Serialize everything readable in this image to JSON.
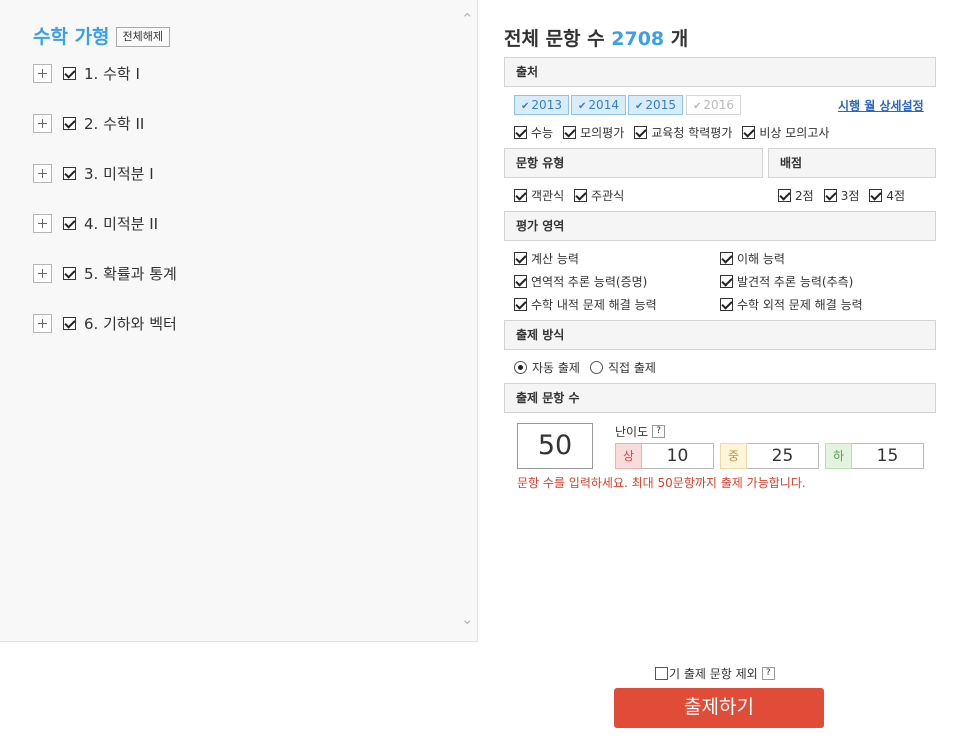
{
  "left_panel": {
    "title": "수학 가형",
    "unselect_all": "전체해제",
    "units": [
      {
        "label": "1. 수학 I",
        "checked": true
      },
      {
        "label": "2. 수학 II",
        "checked": true
      },
      {
        "label": "3. 미적분 I",
        "checked": true
      },
      {
        "label": "4. 미적분 II",
        "checked": true
      },
      {
        "label": "5. 확률과 통계",
        "checked": true
      },
      {
        "label": "6. 기하와 벡터",
        "checked": true
      }
    ]
  },
  "summary": {
    "prefix": "전체 문항 수",
    "count": "2708",
    "suffix": "개"
  },
  "source": {
    "header": "출처",
    "years": [
      {
        "label": "2013",
        "selected": true
      },
      {
        "label": "2014",
        "selected": true
      },
      {
        "label": "2015",
        "selected": true
      },
      {
        "label": "2016",
        "selected": false
      }
    ],
    "detail_link": "시행 월 상세설정",
    "types": [
      {
        "label": "수능",
        "checked": true
      },
      {
        "label": "모의평가",
        "checked": true
      },
      {
        "label": "교육청 학력평가",
        "checked": true
      },
      {
        "label": "비상 모의고사",
        "checked": true
      }
    ]
  },
  "question_type": {
    "header": "문항 유형",
    "options": [
      {
        "label": "객관식",
        "checked": true
      },
      {
        "label": "주관식",
        "checked": true
      }
    ]
  },
  "score": {
    "header": "배점",
    "options": [
      {
        "label": "2점",
        "checked": true
      },
      {
        "label": "3점",
        "checked": true
      },
      {
        "label": "4점",
        "checked": true
      }
    ]
  },
  "eval_area": {
    "header": "평가 영역",
    "options": [
      {
        "label": "계산 능력",
        "checked": true
      },
      {
        "label": "이해 능력",
        "checked": true
      },
      {
        "label": "연역적 추론 능력(증명)",
        "checked": true
      },
      {
        "label": "발견적 추론 능력(추측)",
        "checked": true
      },
      {
        "label": "수학 내적 문제 해결 능력",
        "checked": true
      },
      {
        "label": "수학 외적 문제 해결 능력",
        "checked": true
      }
    ]
  },
  "method": {
    "header": "출제 방식",
    "options": [
      {
        "label": "자동 출제",
        "selected": true
      },
      {
        "label": "직접 출제",
        "selected": false
      }
    ]
  },
  "count": {
    "header": "출제 문항 수",
    "total": "50",
    "difficulty_label": "난이도",
    "help": "?",
    "levels": [
      {
        "tag": "상",
        "value": "10"
      },
      {
        "tag": "중",
        "value": "25"
      },
      {
        "tag": "하",
        "value": "15"
      }
    ],
    "warning": "문항 수를 입력하세요. 최대 50문항까지 출제 가능합니다."
  },
  "footer": {
    "exclude_label": "기 출제 문항 제외",
    "help": "?",
    "submit_label": "출제하기"
  },
  "colors": {
    "accent": "#3d9fe6",
    "submit": "#e04c38",
    "warning": "#d9412f"
  }
}
